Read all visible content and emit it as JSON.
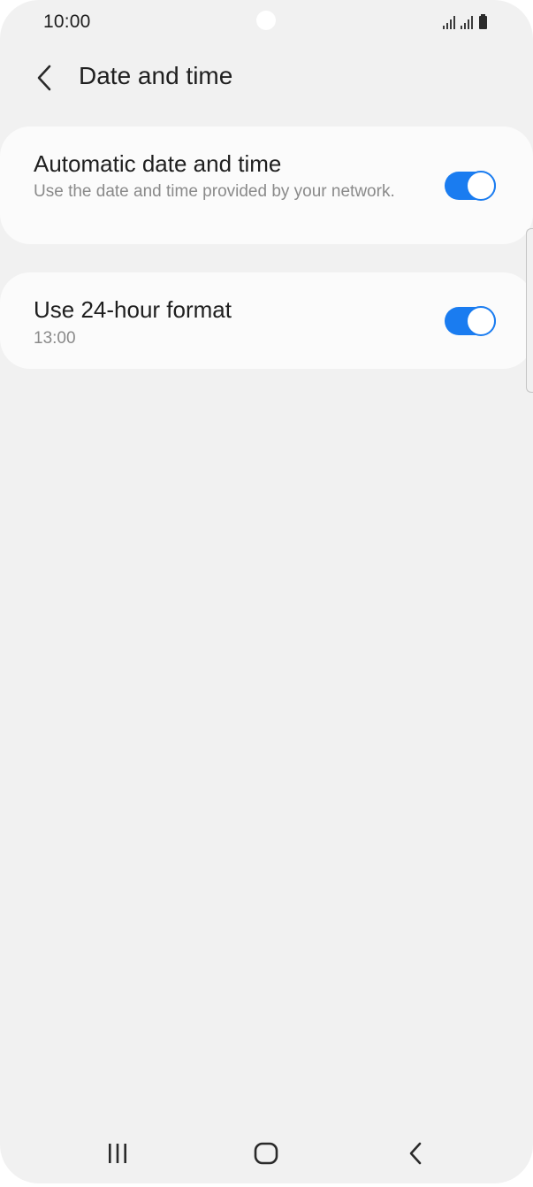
{
  "status_bar": {
    "time": "10:00",
    "icons": [
      "signal-icon",
      "signal-icon",
      "battery-icon"
    ]
  },
  "header": {
    "back_icon": "chevron-left-icon",
    "title": "Date and time"
  },
  "settings": [
    {
      "title": "Automatic date and time",
      "subtitle": "Use the date and time provided by your network.",
      "toggle_on": true
    },
    {
      "title": "Use 24-hour format",
      "subtitle": "13:00",
      "toggle_on": true
    }
  ],
  "nav_bar": {
    "recents_icon": "recents-icon",
    "home_icon": "home-icon",
    "back_icon": "back-icon"
  },
  "colors": {
    "background": "#f1f1f1",
    "card": "#fbfbfb",
    "accent": "#1a7cf0",
    "title_text": "#1f1f1f",
    "subtitle_text": "#8a8a8a"
  }
}
